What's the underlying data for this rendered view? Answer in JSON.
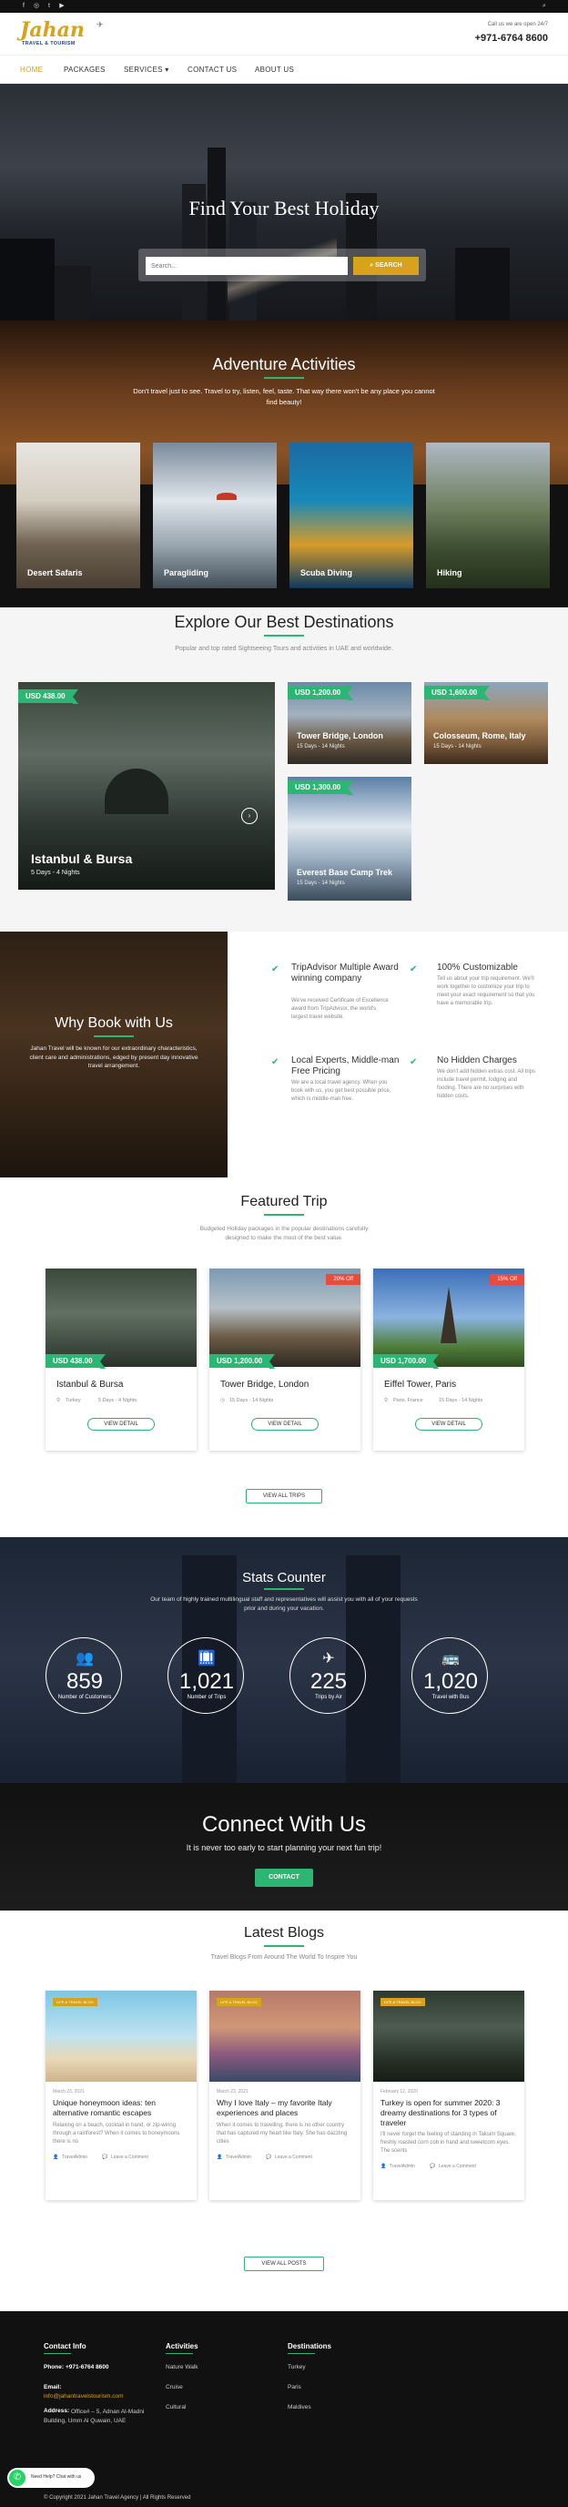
{
  "topbar": {
    "social": [
      "f",
      "◎",
      "t",
      "▶"
    ],
    "search_glyph": "⌕"
  },
  "header": {
    "logo_main": "Jahan",
    "logo_sub": "TRAVEL & TOURISM",
    "contact_note": "Call us we are open 24/7",
    "phone": "+971-6764 8600"
  },
  "nav": {
    "items": [
      "HOME",
      "PACKAGES",
      "SERVICES ▾",
      "CONTACT US",
      "ABOUT US"
    ]
  },
  "hero": {
    "title": "Find Your Best Holiday",
    "search_placeholder": "Search...",
    "search_button": "⌕ SEARCH"
  },
  "adventure": {
    "title": "Adventure Activities",
    "text": "Don't travel just to see. Travel to try, listen, feel, taste. That way there won't be any place you cannot find beauty!",
    "cards": [
      "Desert Safaris",
      "Paragliding",
      "Scuba Diving",
      "Hiking"
    ]
  },
  "explore": {
    "title": "Explore Our Best Destinations",
    "subtitle": "Popular and top rated Sightseeing Tours and activities in UAE and worldwide.",
    "big": {
      "price": "USD 438.00",
      "name": "Istanbul & Bursa",
      "meta": "5 Days - 4 Nights"
    },
    "small": [
      {
        "price": "USD 1,200.00",
        "name": "Tower Bridge, London",
        "meta": "15 Days - 14 Nights"
      },
      {
        "price": "USD 1,600.00",
        "name": "Colosseum, Rome, Italy",
        "meta": "15 Days - 14 Nights"
      },
      {
        "price": "USD 1,300.00",
        "name": "Everest Base Camp Trek",
        "meta": "15 Days - 14 Nights"
      }
    ]
  },
  "why": {
    "title": "Why Book with Us",
    "text": "Jahan Travel will be known for our extraordinary characteristics, client care and administrations, edged by present day innovative travel arrangement.",
    "features": [
      {
        "title": "TripAdvisor Multiple Award winning company",
        "text": "We've received Certificate of Excellence award from TripAdvisor, the world's largest travel website."
      },
      {
        "title": "100% Customizable",
        "text": "Tell us about your trip requirement. We'll work together to customize your trip to meet your exact requirement so that you have a memorable trip."
      },
      {
        "title": "Local Experts, Middle-man Free Pricing",
        "text": "We are a local travel agency. When you book with us, you get best possible price, which is middle-man free."
      },
      {
        "title": "No Hidden Charges",
        "text": "We don't add hidden extras cost. All trips include travel permit, lodging and fooding. There are no surprises with hidden costs."
      }
    ]
  },
  "featured": {
    "title": "Featured Trip",
    "subtitle": "Budgeted Holiday packages in the popular destinations carefully designed to make the most of the best value.",
    "cards": [
      {
        "price": "USD 438.00",
        "name": "Istanbul & Bursa",
        "location": "Turkey",
        "meta": "5 Days - 4 Nights",
        "discount": "",
        "button": "VIEW DETAIL"
      },
      {
        "price": "USD 1,200.00",
        "name": "Tower Bridge, London",
        "location": "",
        "meta": "15 Days - 14 Nights",
        "discount": "20% Off",
        "button": "VIEW DETAIL"
      },
      {
        "price": "USD 1,700.00",
        "name": "Eiffel Tower, Paris",
        "location": "Paris, France",
        "meta": "15 Days - 14 Nights",
        "discount": "15% Off",
        "button": "VIEW DETAIL"
      }
    ],
    "view_all": "VIEW ALL TRIPS"
  },
  "stats": {
    "title": "Stats Counter",
    "text": "Our team of highly trained multilingual staff and representatives will assist you with all of your requests prior and during your vacation.",
    "items": [
      {
        "icon": "👥",
        "value": "859",
        "label": "Number of Customers"
      },
      {
        "icon": "🛄",
        "value": "1,021",
        "label": "Number of Trips"
      },
      {
        "icon": "✈",
        "value": "225",
        "label": "Trips by Air"
      },
      {
        "icon": "🚌",
        "value": "1,020",
        "label": "Travel with Bus"
      }
    ]
  },
  "connect": {
    "title": "Connect With Us",
    "text": "It is never too early to start planning your next fun trip!",
    "button": "CONTACT"
  },
  "blogs": {
    "title": "Latest Blogs",
    "subtitle": "Travel Blogs From Around The World To Inspire You",
    "cards": [
      {
        "category": "LIFE & TRAVEL BLOG",
        "date": "March 23, 2021",
        "title": "Unique honeymoon ideas: ten alternative romantic escapes",
        "text": "Relaxing on a beach, cocktail in hand, or zip-wiring through a rainforest? When it comes to honeymoons there is no",
        "author": "TravelAdmin",
        "comment": "Leave a Comment"
      },
      {
        "category": "LIFE & TRAVEL BLOG",
        "date": "March 23, 2021",
        "title": "Why I love Italy – my favorite Italy experiences and places",
        "text": "When it comes to travelling, there is no other country that has captured my heart like Italy. She has dazzling cities",
        "author": "TravelAdmin",
        "comment": "Leave a Comment"
      },
      {
        "category": "LIFE & TRAVEL BLOG",
        "date": "February 12, 2020",
        "title": "Turkey is open for summer 2020: 3 dreamy destinations for 3 types of traveler",
        "text": "I'll never forget the feeling of standing in Taksim Square, freshly roasted corn cob in hand and sweetcorn eyes. The scents",
        "author": "TravelAdmin",
        "comment": "Leave a Comment"
      }
    ],
    "view_all": "VIEW ALL POSTS"
  },
  "footer": {
    "contact_title": "Contact Info",
    "phone_label": "Phone:",
    "phone": "+971-6764 8600",
    "email_label": "Email:",
    "email": "info@jahantravelstourism.com",
    "address_label": "Address:",
    "address": "Office# – 5, Adnan Al-Madni Building, Umm Al Quwain, UAE",
    "activities_title": "Activities",
    "activities": [
      "Nature Walk",
      "Cruise",
      "Cultural"
    ],
    "destinations_title": "Destinations",
    "destinations": [
      "Turkey",
      "Paris",
      "Maldives"
    ],
    "whatsapp": "Need Help? Chat with us",
    "copyright": "© Copyright 2021 Jahan Travel Agency | All Rights Reserved"
  },
  "colors": {
    "accent": "#2bb673",
    "gold": "#d8a21a",
    "dark": "#111111",
    "discount": "#e74c3c"
  }
}
